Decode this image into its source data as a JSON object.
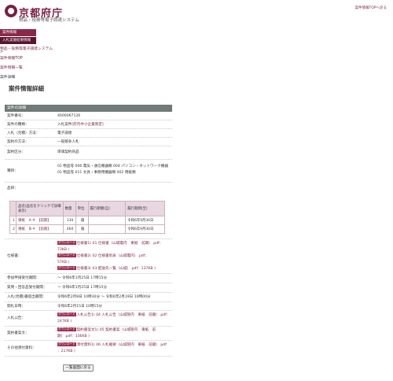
{
  "header": {
    "site_title": "京都府庁",
    "site_subtitle": "物品・役務等電子調達システム",
    "top_link": "案件情報TOPへ戻る"
  },
  "menu": {
    "items": [
      {
        "label": "案件情報"
      },
      {
        "label": "入札実施結果情報"
      }
    ]
  },
  "breadcrumb": {
    "home": "物品・役務等電子調達システム",
    "sep": ">",
    "top": "案件情報TOP",
    "list": "案件情報一覧",
    "current": "案件詳細"
  },
  "page_title": "案件情報詳細",
  "panel": {
    "heading": "案件の詳細",
    "fields": {
      "number_label": "案件番号：",
      "number_value": "4000067126",
      "type_label": "案件の種類：",
      "type_value": "入札案件",
      "type_link": "[府内中小企業限定]",
      "method_label": "入札（見積）方法：",
      "method_value": "電子調達",
      "contract_method_label": "契約の方法：",
      "contract_method_value": "一般競争入札",
      "contract_class_label": "契約区分：",
      "contract_class_value": "単価契約商品",
      "category_label": "種目：",
      "category_line1": "01 物品等 006 電気・通信機器類 004 パソコン・ネットワーク機器",
      "category_line2": "01 物品等 011 文具・事務用機器類 002 用紙類",
      "goods_label": "品目：",
      "spec_label": "仕様書：",
      "spec_files": [
        {
          "badge": "ダウンロード",
          "text": "仕様書1( 01 仕様書（山城電内　東紙　前期）.pdf："
        },
        {
          "badge": "",
          "text": "73KB )"
        },
        {
          "badge": "ダウンロード",
          "text": "仕様書2( 02 仕様書別表（山城電内）.pdf："
        },
        {
          "badge": "",
          "text": "57KB )"
        },
        {
          "badge": "ダウンロード",
          "text": "仕様書3( 03 配送先一覧（山城）.pdf：137KB )"
        }
      ],
      "apply_label": "参加申請受付期間：",
      "apply_value": "～ 令和6年1月25日 17時15分",
      "question_label": "質問・回答品受付期間：",
      "question_value": "～ 令和6年1月25日 17時15分",
      "bid_label": "入札(見積)書提出期間：",
      "bid_value": "令和6年2月8日 10時30分 ～ 令和6年2月19日 10時00分",
      "open_label": "開札日時：",
      "open_value": "令和6年2月15日 10時15分",
      "notice_label": "入札公告：",
      "notice_file": "入札公告1( 04 入札公告（山城管内　東紙　前期）.pdf：",
      "notice_size": "247KB )",
      "contract_doc_label": "契約書案文：",
      "contract_doc_file": "契約書案文1( 05 契約書案（山城管内　東紙　前期）.pdf：336KB )",
      "other_label": "その他添付資料：",
      "other_file": "添付資料1( 06 入札概要（山城管内　東紙　前期）.pdf",
      "other_size": "：217KB )",
      "download_badge": "ダウンロード"
    }
  },
  "goods_table": {
    "headers": [
      "",
      "品名(品名をクリックで詳細表示)",
      "数量",
      "単位",
      "履行期間(自)",
      "履行期間(至)"
    ],
    "rows": [
      {
        "no": "1",
        "name": "東紙　Ａ４　【前期】",
        "qty": "130",
        "unit": "箱",
        "from": "",
        "to": "令和6年9月30日"
      },
      {
        "no": "2",
        "name": "東紙　Ｂ４　【前期】",
        "qty": "460",
        "unit": "箱",
        "from": "",
        "to": "令和6年9月30日"
      }
    ]
  },
  "back_button": "一覧画面に戻る",
  "colors": {
    "brand": "#7a1f3d",
    "panel_head": "#707a78",
    "table_head": "#e8d7df"
  }
}
